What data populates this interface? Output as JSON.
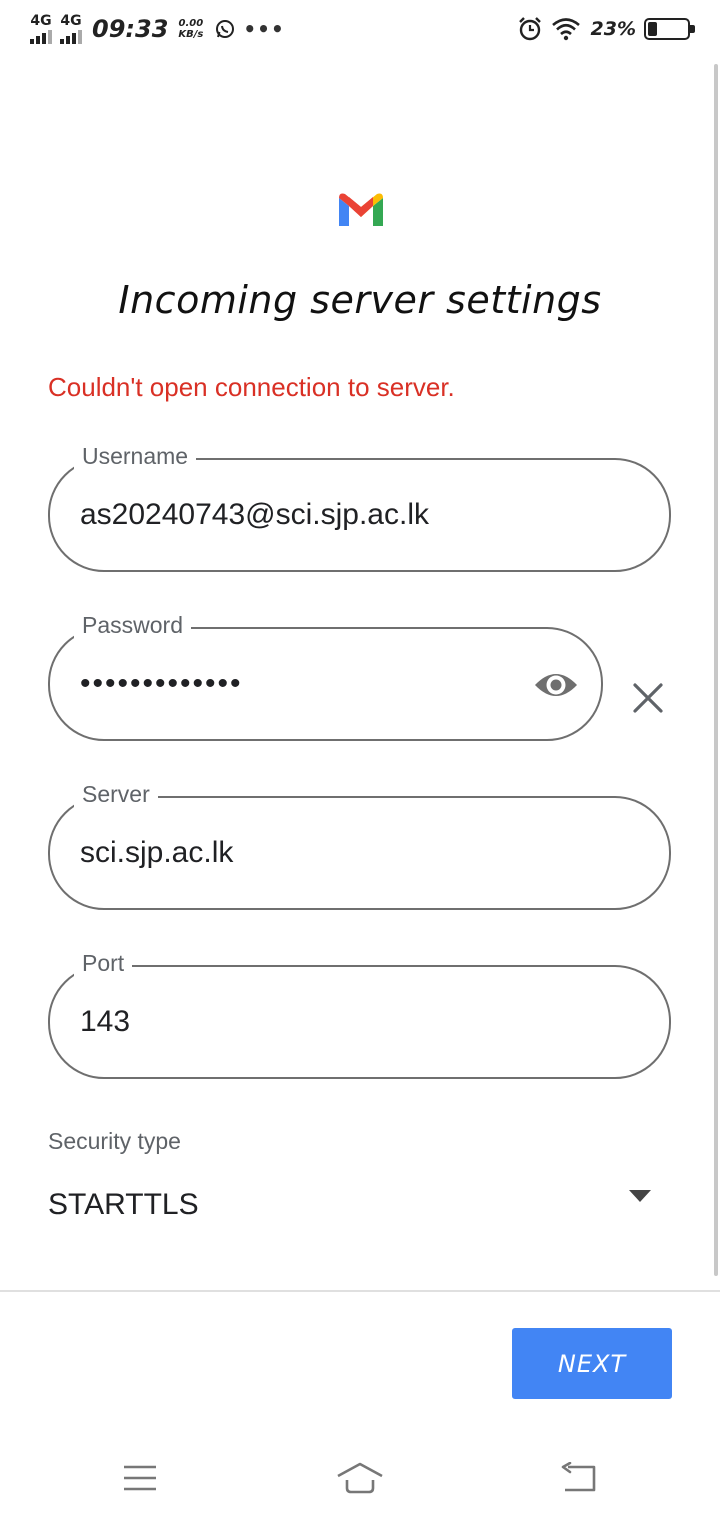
{
  "status_bar": {
    "sim1_label": "4G",
    "sim2_label": "4G",
    "time": "09:33",
    "speed_value": "0.00",
    "speed_unit": "KB/s",
    "more": "•••",
    "battery_percent_text": "23%",
    "battery_level": 0.23,
    "icons": [
      "signal-icon",
      "whatsapp-icon",
      "alarm-icon",
      "wifi-icon",
      "battery-icon"
    ]
  },
  "app": {
    "logo": "gmail-logo",
    "title": "Incoming server settings",
    "error": "Couldn't open connection to server."
  },
  "form": {
    "username": {
      "label": "Username",
      "value": "as20240743@sci.sjp.ac.lk"
    },
    "password": {
      "label": "Password",
      "value": "•••••••••••••"
    },
    "server": {
      "label": "Server",
      "value": "sci.sjp.ac.lk"
    },
    "port": {
      "label": "Port",
      "value": "143"
    },
    "security": {
      "label": "Security type",
      "value": "STARTTLS"
    }
  },
  "actions": {
    "next_label": "NEXT"
  },
  "colors": {
    "error": "#d93025",
    "primary": "#4285f4",
    "outline": "#6f6f6f"
  },
  "nav_bar": {
    "icons": [
      "menu-icon",
      "home-icon",
      "back-icon"
    ]
  }
}
